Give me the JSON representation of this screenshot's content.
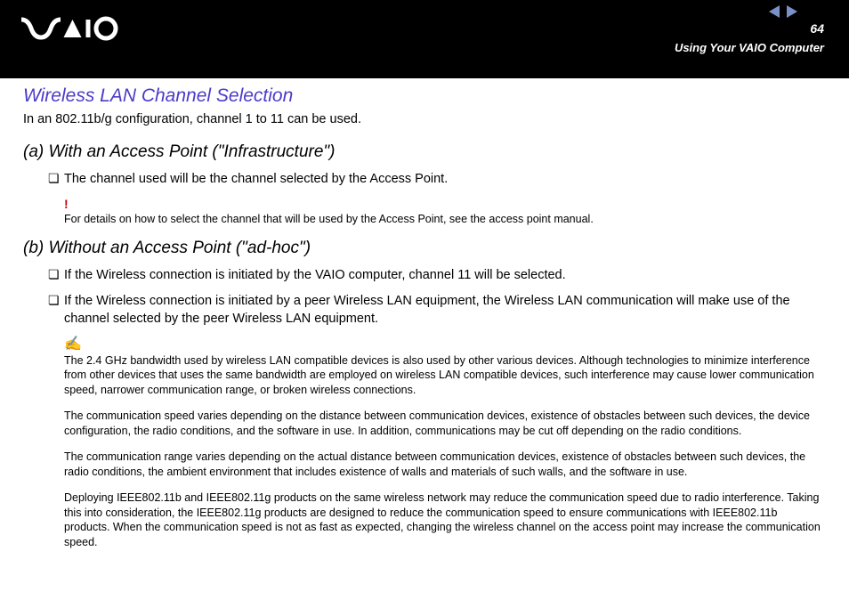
{
  "header": {
    "page_number": "64",
    "section": "Using Your VAIO Computer"
  },
  "title": "Wireless LAN Channel Selection",
  "intro": "In an 802.11b/g configuration, channel 1 to 11 can be used.",
  "section_a": {
    "heading": "(a) With an Access Point (\"Infrastructure\")",
    "bullet1": "The channel used will be the channel selected by the Access Point.",
    "alert_mark": "!",
    "alert_text": "For details on how to select the channel that will be used by the Access Point, see the access point manual."
  },
  "section_b": {
    "heading": "(b) Without an Access Point (\"ad-hoc\")",
    "bullet1": "If the Wireless connection is initiated by the VAIO computer, channel 11 will be selected.",
    "bullet2": "If the Wireless connection is initiated by a peer Wireless LAN equipment, the Wireless LAN communication will make use of the channel selected by the peer Wireless LAN equipment.",
    "note_mark": "✍",
    "note1": "The 2.4 GHz bandwidth used by wireless LAN compatible devices is also used by other various devices. Although technologies to minimize interference from other devices that uses the same bandwidth are employed on wireless LAN compatible devices, such interference may cause lower communication speed, narrower communication range, or broken wireless connections.",
    "note2": "The communication speed varies depending on the distance between communication devices, existence of obstacles between such devices, the device configuration, the radio conditions, and the software in use. In addition, communications may be cut off depending on the radio conditions.",
    "note3": "The communication range varies depending on the actual distance between communication devices, existence of obstacles between such devices, the radio conditions, the ambient environment that includes existence of walls and materials of such walls, and the software in use.",
    "note4": "Deploying IEEE802.11b and IEEE802.11g products on the same wireless network may reduce the communication speed due to radio interference. Taking this into consideration, the IEEE802.11g products are designed to reduce the communication speed to ensure communications with IEEE802.11b products. When the communication speed is not as fast as expected, changing the wireless channel on the access point may increase the communication speed."
  },
  "bullet_glyph": "❏"
}
